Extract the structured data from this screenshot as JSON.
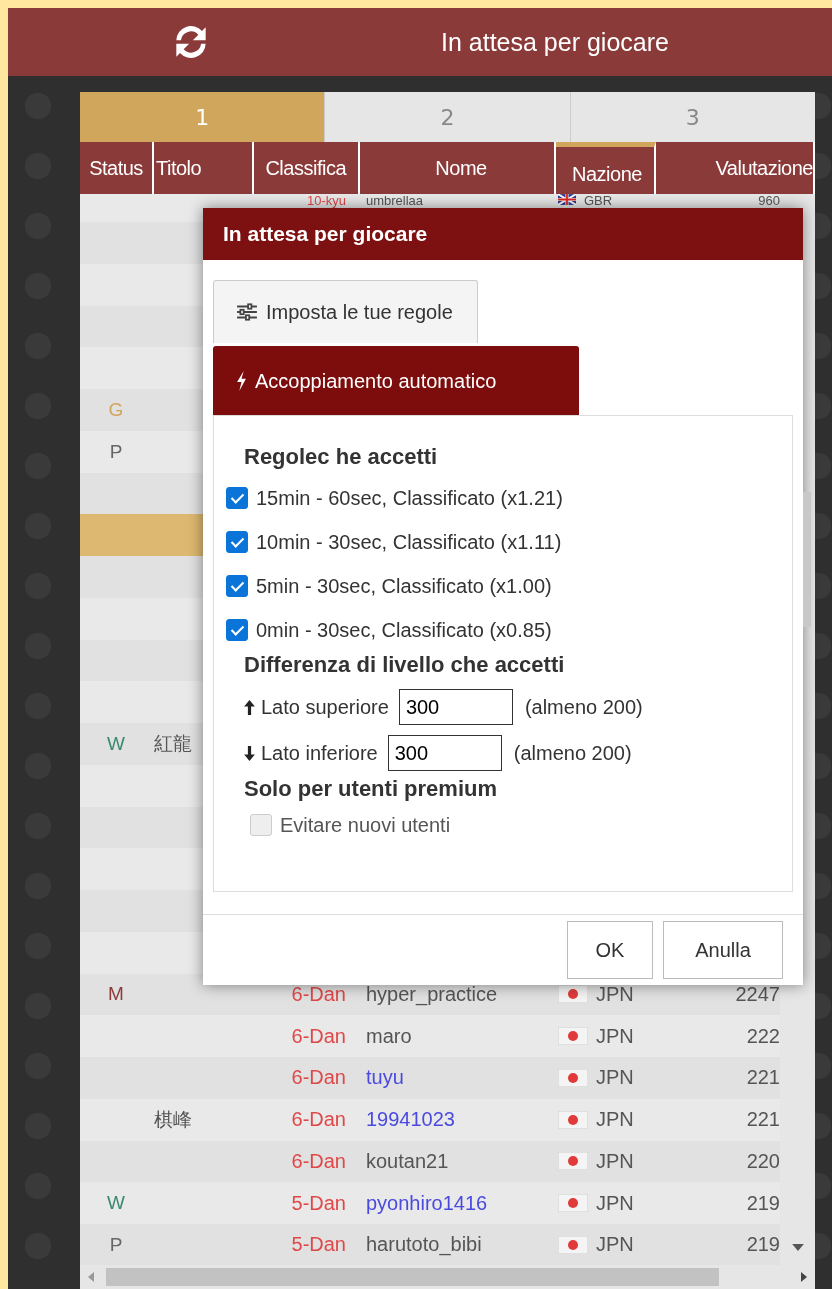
{
  "header": {
    "title": "In attesa per giocare"
  },
  "tabs": [
    {
      "label": "1",
      "selected": true
    },
    {
      "label": "2",
      "selected": false
    },
    {
      "label": "3",
      "selected": false
    }
  ],
  "columns": [
    {
      "label": "Status",
      "sorted": false
    },
    {
      "label": "Titolo",
      "sorted": false
    },
    {
      "label": "Classifica",
      "sorted": false
    },
    {
      "label": "Nome",
      "sorted": false
    },
    {
      "label": "Nazione",
      "sorted": true
    },
    {
      "label": "Valutazione",
      "sorted": false
    }
  ],
  "rows": [
    {
      "rank": "10-kyu",
      "name": {
        "text": "umbrellaa",
        "color": "#555555"
      },
      "nation": {
        "kind": "gb",
        "code": "GBR"
      },
      "rating": "960"
    },
    {},
    {},
    {},
    {},
    {
      "status": {
        "text": "G",
        "color": "#d4a35c"
      }
    },
    {
      "status": {
        "text": "P",
        "color": "#666666"
      }
    },
    {},
    {
      "selected": true
    },
    {},
    {},
    {},
    {},
    {
      "status": {
        "text": "W",
        "color": "#3a8a6e"
      },
      "title": "紅龍"
    },
    {},
    {},
    {},
    {},
    {},
    {
      "status": {
        "text": "M",
        "color": "#8b3a3a"
      },
      "rank": "6-Dan",
      "name": {
        "text": "hyper_practice",
        "color": "#555555"
      },
      "nation": {
        "kind": "jp",
        "code": "JPN"
      },
      "rating": "2247"
    },
    {
      "rank": "6-Dan",
      "name": {
        "text": "maro",
        "color": "#555555"
      },
      "nation": {
        "kind": "jp",
        "code": "JPN"
      },
      "rating": "222"
    },
    {
      "rank": "6-Dan",
      "name": {
        "text": "tuyu",
        "color": "#4a4ae0"
      },
      "nation": {
        "kind": "jp",
        "code": "JPN"
      },
      "rating": "221"
    },
    {
      "title": "棋峰",
      "rank": "6-Dan",
      "name": {
        "text": "19941023",
        "color": "#4a4ae0"
      },
      "nation": {
        "kind": "jp",
        "code": "JPN"
      },
      "rating": "221"
    },
    {
      "rank": "6-Dan",
      "name": {
        "text": "koutan21",
        "color": "#555555"
      },
      "nation": {
        "kind": "jp",
        "code": "JPN"
      },
      "rating": "220"
    },
    {
      "status": {
        "text": "W",
        "color": "#3a8a6e"
      },
      "rank": "5-Dan",
      "name": {
        "text": "pyonhiro1416",
        "color": "#4a4ae0"
      },
      "nation": {
        "kind": "jp",
        "code": "JPN"
      },
      "rating": "219"
    },
    {
      "status": {
        "text": "P",
        "color": "#666666"
      },
      "rank": "5-Dan",
      "name": {
        "text": "harutoto_bibi",
        "color": "#555555"
      },
      "nation": {
        "kind": "jp",
        "code": "JPN"
      },
      "rating": "219"
    }
  ],
  "dialog": {
    "title": "In attesa per giocare",
    "tabs": [
      {
        "label": "Imposta le tue regole",
        "selected": false
      },
      {
        "label": "Accoppiamento automatico",
        "selected": true
      }
    ],
    "rules_heading": "Regolec he accetti",
    "rules": [
      {
        "label": "15min - 60sec, Classificato (x1.21)",
        "checked": true
      },
      {
        "label": "10min - 30sec, Classificato (x1.11)",
        "checked": true
      },
      {
        "label": " 5min - 30sec, Classificato (x1.00)",
        "checked": true
      },
      {
        "label": " 0min - 30sec, Classificato (x0.85)",
        "checked": true
      }
    ],
    "level_heading": "Differenza di livello che accetti",
    "levels": [
      {
        "label": "Lato superiore",
        "value": "300",
        "hint": "(almeno 200)"
      },
      {
        "label": "Lato inferiore",
        "value": "300",
        "hint": "(almeno 200)"
      }
    ],
    "premium_heading": "Solo per utenti premium",
    "premium_option": {
      "label": "Evitare nuovi utenti",
      "checked": false,
      "disabled": true
    },
    "buttons": [
      "OK",
      "Anulla"
    ]
  }
}
